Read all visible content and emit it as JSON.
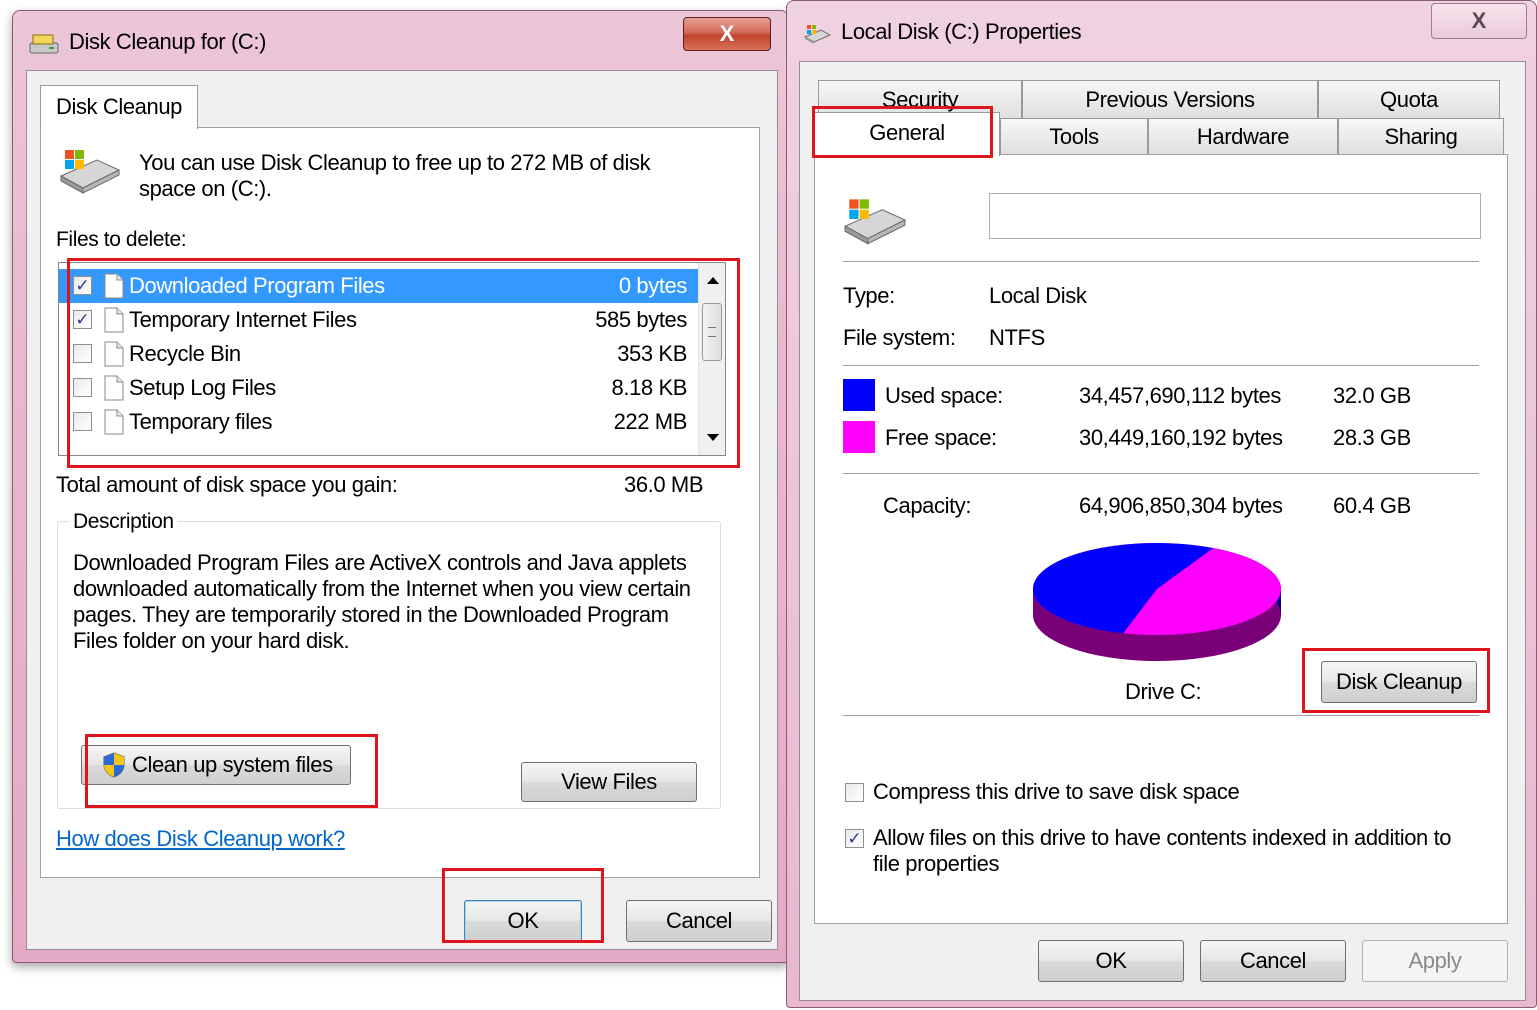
{
  "cleanup": {
    "title": "Disk Cleanup for  (C:)",
    "close": "X",
    "tab": "Disk Cleanup",
    "intro_line1": "You can use Disk Cleanup to free up to 272 MB of disk",
    "intro_line2": "space on  (C:).",
    "files_label": "Files to delete:",
    "files": [
      {
        "name": "Downloaded Program Files",
        "size": "0 bytes",
        "checked": true,
        "selected": true
      },
      {
        "name": "Temporary Internet Files",
        "size": "585 bytes",
        "checked": true,
        "selected": false
      },
      {
        "name": "Recycle Bin",
        "size": "353 KB",
        "checked": false,
        "selected": false
      },
      {
        "name": "Setup Log Files",
        "size": "8.18 KB",
        "checked": false,
        "selected": false
      },
      {
        "name": "Temporary files",
        "size": "222 MB",
        "checked": false,
        "selected": false
      }
    ],
    "total_label": "Total amount of disk space you gain:",
    "total_value": "36.0 MB",
    "description_label": "Description",
    "description_lines": [
      "Downloaded Program Files are ActiveX controls and Java applets",
      "downloaded automatically from the Internet when you view certain",
      "pages. They are temporarily stored in the Downloaded Program",
      "Files folder on your hard disk."
    ],
    "cleanup_system_button": "Clean up system files",
    "view_files_button": "View Files",
    "help_link": "How does Disk Cleanup work?",
    "ok_button": "OK",
    "cancel_button": "Cancel"
  },
  "properties": {
    "title": "Local Disk (C:) Properties",
    "close": "X",
    "tabs_row1": [
      "Security",
      "Previous Versions",
      "Quota"
    ],
    "tabs_row2": [
      "General",
      "Tools",
      "Hardware",
      "Sharing"
    ],
    "drive_name_value": "",
    "type_label": "Type:",
    "type_value": "Local Disk",
    "fs_label": "File system:",
    "fs_value": "NTFS",
    "used_label": "Used space:",
    "used_bytes": "34,457,690,112 bytes",
    "used_gb": "32.0 GB",
    "free_label": "Free space:",
    "free_bytes": "30,449,160,192 bytes",
    "free_gb": "28.3 GB",
    "capacity_label": "Capacity:",
    "capacity_bytes": "64,906,850,304 bytes",
    "capacity_gb": "60.4 GB",
    "drive_label": "Drive C:",
    "disk_cleanup_button": "Disk Cleanup",
    "compress_label": "Compress this drive to save disk space",
    "compress_checked": false,
    "index_line1": "Allow files on this drive to have contents indexed in addition to",
    "index_line2": "file properties",
    "index_checked": true,
    "ok_button": "OK",
    "cancel_button": "Cancel",
    "apply_button": "Apply",
    "used_color": "#0000ff",
    "free_color": "#ff00ff",
    "used_fraction": 0.531
  }
}
